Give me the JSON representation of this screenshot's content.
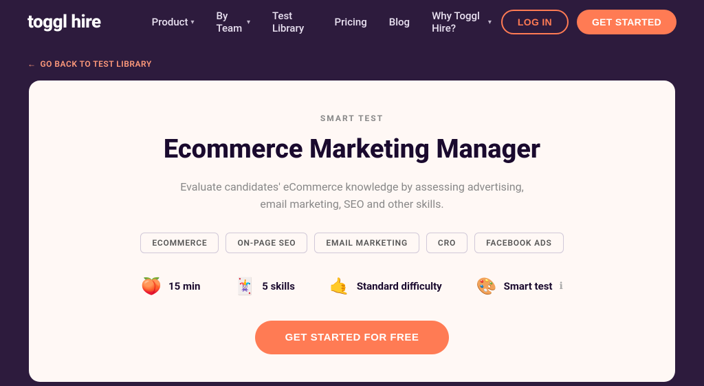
{
  "nav": {
    "logo": {
      "brand": "toggl",
      "suffix": " hire"
    },
    "links": [
      {
        "label": "Product",
        "hasDropdown": true
      },
      {
        "label": "By Team",
        "hasDropdown": true
      },
      {
        "label": "Test Library",
        "hasDropdown": false
      },
      {
        "label": "Pricing",
        "hasDropdown": false
      },
      {
        "label": "Blog",
        "hasDropdown": false
      },
      {
        "label": "Why Toggl Hire?",
        "hasDropdown": true
      }
    ],
    "login_label": "LOG IN",
    "get_started_label": "GET STARTED"
  },
  "breadcrumb": {
    "arrow": "←",
    "label": "GO BACK TO TEST LIBRARY"
  },
  "card": {
    "smart_test_label": "SMART TEST",
    "title": "Ecommerce Marketing Manager",
    "description": "Evaluate candidates' eCommerce knowledge by assessing advertising, email marketing, SEO and other skills.",
    "tags": [
      "ECOMMERCE",
      "ON-PAGE SEO",
      "EMAIL MARKETING",
      "CRO",
      "FACEBOOK ADS"
    ],
    "meta": [
      {
        "icon": "🍑",
        "text": "15 min"
      },
      {
        "icon": "🃏",
        "text": "5 skills"
      },
      {
        "icon": "🤙",
        "text": "Standard difficulty"
      },
      {
        "icon": "🎨",
        "text": "Smart test",
        "info": "ℹ"
      }
    ],
    "cta_label": "GET STARTED FOR FREE"
  }
}
